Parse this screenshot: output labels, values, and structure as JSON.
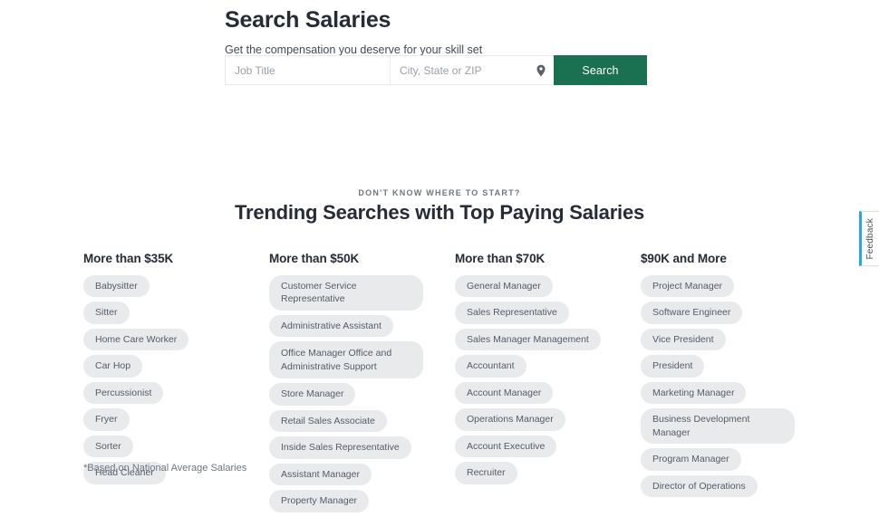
{
  "hero": {
    "title": "Search Salaries",
    "subtitle": "Get the compensation you deserve for your skill set",
    "job_input": {
      "placeholder": "Job Title",
      "value": ""
    },
    "location_input": {
      "placeholder": "City, State or ZIP",
      "value": ""
    },
    "location_icon": "map-pin-icon",
    "search_button": "Search",
    "accent_color": "#1a7151"
  },
  "trending": {
    "eyebrow": "DON'T KNOW WHERE TO START?",
    "title": "Trending Searches with Top Paying Salaries",
    "columns": [
      {
        "heading": "More than $35K",
        "items": [
          "Babysitter",
          "Sitter",
          "Home Care Worker",
          "Car Hop",
          "Percussionist",
          "Fryer",
          "Sorter",
          "Head Cleaner"
        ]
      },
      {
        "heading": "More than $50K",
        "items": [
          "Customer Service Representative",
          "Administrative Assistant",
          "Office Manager Office and Administrative Support",
          "Store Manager",
          "Retail Sales Associate",
          "Inside Sales Representative",
          "Assistant Manager",
          "Property Manager"
        ]
      },
      {
        "heading": "More than $70K",
        "items": [
          "General Manager",
          "Sales Representative",
          "Sales Manager Management",
          "Accountant",
          "Account Manager",
          "Operations Manager",
          "Account Executive",
          "Recruiter"
        ]
      },
      {
        "heading": "$90K and More",
        "items": [
          "Project Manager",
          "Software Engineer",
          "Vice President",
          "President",
          "Marketing Manager",
          "Business Development Manager",
          "Program Manager",
          "Director of Operations"
        ]
      }
    ]
  },
  "footnote": "*Based on National Average Salaries",
  "feedback": {
    "label": "Feedback",
    "accent_color": "#2ba6e0"
  }
}
